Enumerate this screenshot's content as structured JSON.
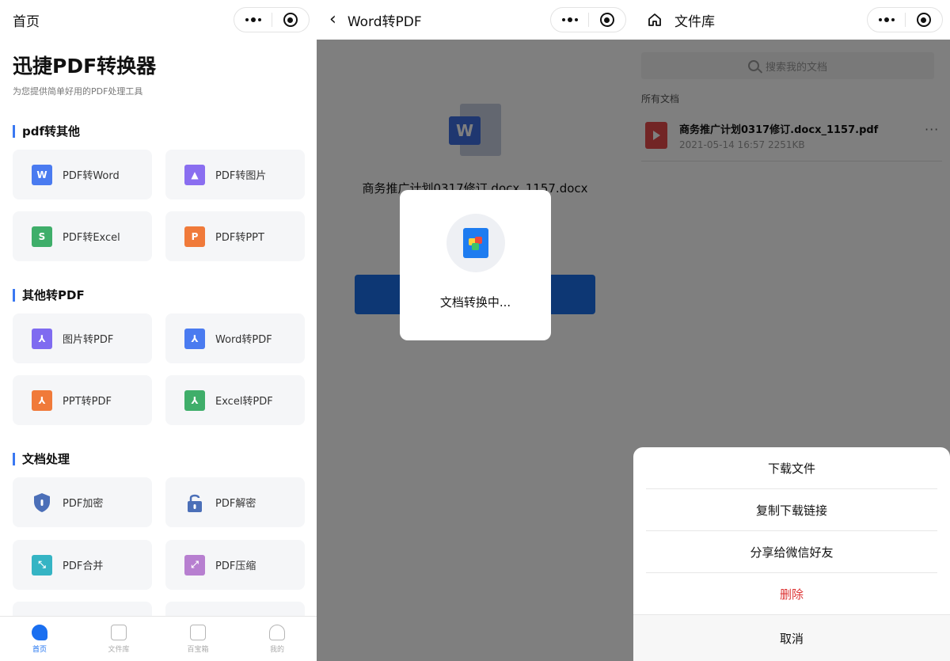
{
  "panel1": {
    "nav_title": "首页",
    "app_title": "迅捷PDF转换器",
    "app_subtitle": "为您提供简单好用的PDF处理工具",
    "sections": [
      {
        "title": "pdf转其他",
        "items": [
          {
            "label": "PDF转Word",
            "icon": "word-icon"
          },
          {
            "label": "PDF转图片",
            "icon": "image-icon"
          },
          {
            "label": "PDF转Excel",
            "icon": "excel-icon"
          },
          {
            "label": "PDF转PPT",
            "icon": "ppt-icon"
          }
        ]
      },
      {
        "title": "其他转PDF",
        "items": [
          {
            "label": "图片转PDF",
            "icon": "pdf-icon"
          },
          {
            "label": "Word转PDF",
            "icon": "pdf-icon"
          },
          {
            "label": "PPT转PDF",
            "icon": "pdf-icon"
          },
          {
            "label": "Excel转PDF",
            "icon": "pdf-icon"
          }
        ]
      },
      {
        "title": "文档处理",
        "items": [
          {
            "label": "PDF加密",
            "icon": "shield-icon"
          },
          {
            "label": "PDF解密",
            "icon": "unlock-icon"
          },
          {
            "label": "PDF合并",
            "icon": "merge-icon"
          },
          {
            "label": "PDF压缩",
            "icon": "compress-icon"
          }
        ]
      }
    ],
    "tabs": [
      {
        "label": "首页",
        "active": true
      },
      {
        "label": "文件库",
        "active": false
      },
      {
        "label": "百宝箱",
        "active": false
      },
      {
        "label": "我的",
        "active": false
      }
    ]
  },
  "panel2": {
    "nav_title": "Word转PDF",
    "file_name": "商务推广计划0317修订.docx_1157.docx",
    "doc_icon_letter": "W",
    "loading_text": "文档转换中..."
  },
  "panel3": {
    "nav_title": "文件库",
    "search_placeholder": "搜索我的文档",
    "all_docs_label": "所有文档",
    "file": {
      "name": "商务推广计划0317修订.docx_1157.pdf",
      "meta": "2021-05-14 16:57 2251KB"
    },
    "sheet_options": [
      "下载文件",
      "复制下载链接",
      "分享给微信好友",
      "删除"
    ],
    "cancel_label": "取消"
  },
  "colors": {
    "accent": "#1a6ff0",
    "danger": "#d33333",
    "overlay": "rgba(0,0,0,0.5)"
  }
}
